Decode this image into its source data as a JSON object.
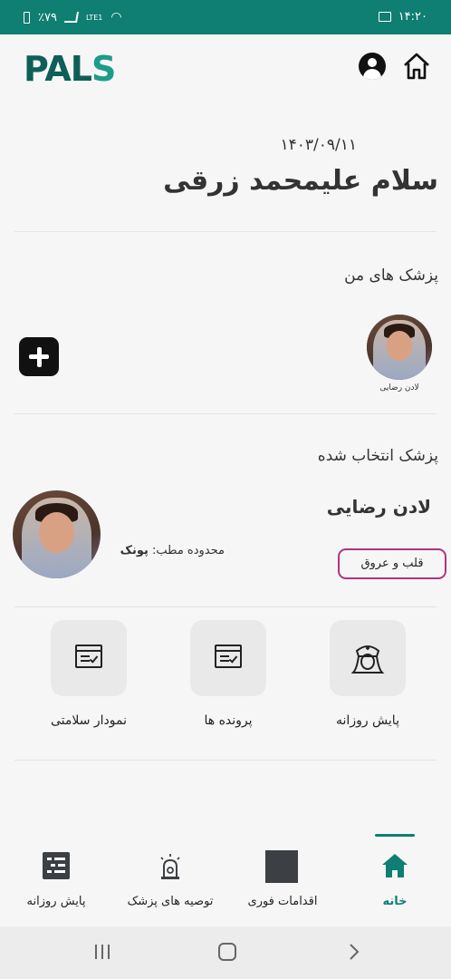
{
  "status_bar": {
    "battery": "٪۷۹",
    "network": "LTE1",
    "time": "۱۴:۲۰"
  },
  "header": {
    "logo_main": "PAL",
    "logo_accent": "S",
    "profile_icon": "account-circle-icon",
    "home_icon": "home-icon"
  },
  "greeting": {
    "date": "۱۴۰۳/۰۹/۱۱",
    "text": "سلام علیمحمد زرقی"
  },
  "my_doctors": {
    "title": "پزشک های من",
    "items": [
      {
        "name": "لادن رضایی"
      }
    ],
    "add_icon": "plus-icon"
  },
  "selected_doctor": {
    "title": "پزشک انتخاب شده",
    "name": "لادن رضایی",
    "area_label": "محدوده مطب:",
    "area_value": "پونک",
    "specialty": "قلب و عروق",
    "accent": "#b0347d"
  },
  "tiles": [
    {
      "label": "پایش روزانه",
      "icon": "nurse-icon"
    },
    {
      "label": "پرونده ها",
      "icon": "checklist-document-icon"
    },
    {
      "label": "نمودار سلامتی",
      "icon": "checklist-document-icon"
    }
  ],
  "bottom_nav": {
    "items": [
      {
        "label": "خانه",
        "icon": "home-icon",
        "active": true
      },
      {
        "label": "اقدامات فوری",
        "icon": "square-icon",
        "active": false
      },
      {
        "label": "توصیه های پزشک",
        "icon": "alarm-light-icon",
        "active": false
      },
      {
        "label": "پایش روزانه",
        "icon": "list-icon",
        "active": false
      }
    ]
  },
  "colors": {
    "primary": "#0f7e73",
    "background": "#f6f6f6"
  }
}
